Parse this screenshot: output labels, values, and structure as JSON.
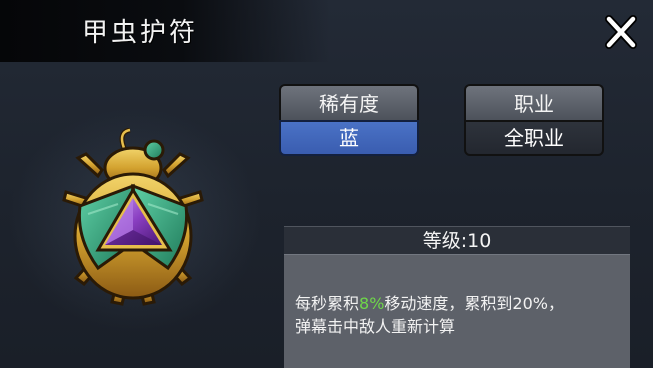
{
  "window": {
    "title": "甲虫护符"
  },
  "icons": {
    "close": "close-icon",
    "item": "scarab-amulet-icon"
  },
  "rarity": {
    "label": "稀有度",
    "value": "蓝",
    "color": "#3f63b8"
  },
  "class": {
    "label": "职业",
    "value": "全职业"
  },
  "details": {
    "level_label": "等级:10",
    "description": {
      "prefix": "每秒累积",
      "highlight": "8%",
      "suffix": "移动速度，累积到20%，",
      "line2": "弹幕击中敌人重新计算",
      "highlight_color": "#6fd64a"
    }
  }
}
